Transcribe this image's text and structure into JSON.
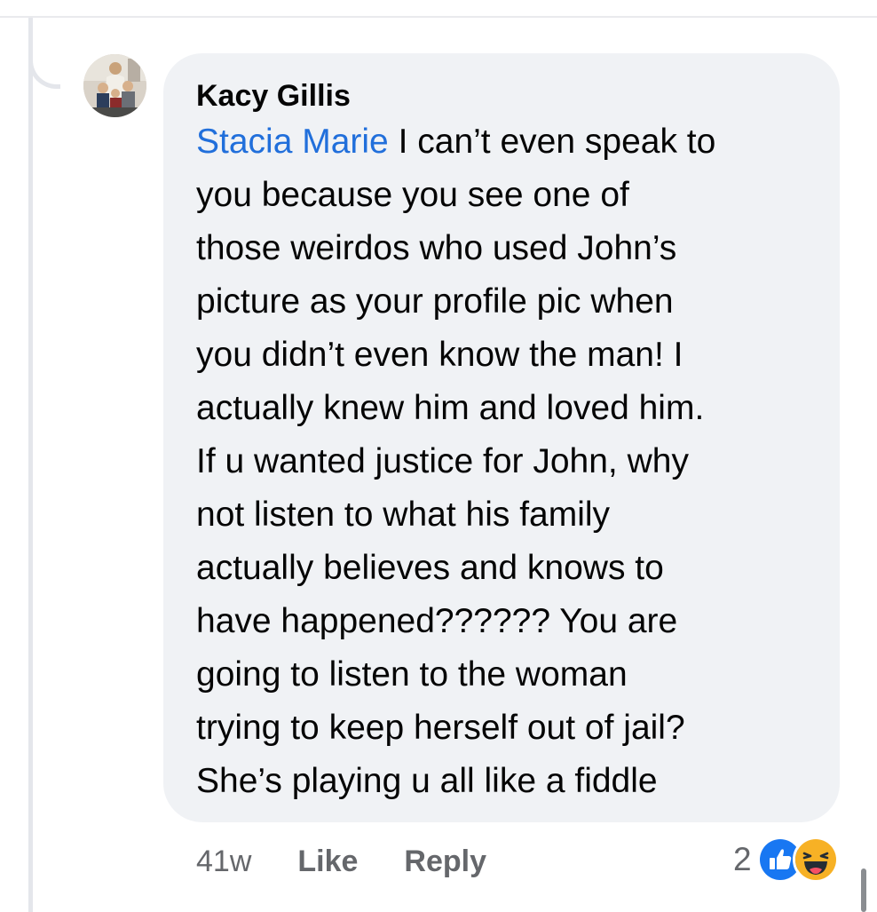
{
  "comment": {
    "author": "Kacy Gillis",
    "mention": "Stacia Marie",
    "lines": [
      " I can’t even speak to",
      "you because you see one of",
      "those weirdos who used John’s",
      "picture as your profile pic when",
      "you didn’t even know the man! I",
      "actually knew him and loved him.",
      "If u wanted justice for John, why",
      "not listen to what his family",
      "actually believes and knows to",
      "have happened?????? You are",
      "going to listen to the woman",
      "trying to keep herself out of jail?",
      "She’s playing u all like a fiddle"
    ]
  },
  "actions": {
    "timestamp": "41w",
    "like_label": "Like",
    "reply_label": "Reply"
  },
  "reactions": {
    "count": "2",
    "icons": [
      "like-reaction-icon",
      "haha-reaction-icon"
    ]
  },
  "colors": {
    "mention": "#216fdb",
    "bubble": "#f0f2f5",
    "meta_text": "#65676b",
    "like_blue": "#1877f2",
    "haha_yellow": "#f7b125"
  }
}
